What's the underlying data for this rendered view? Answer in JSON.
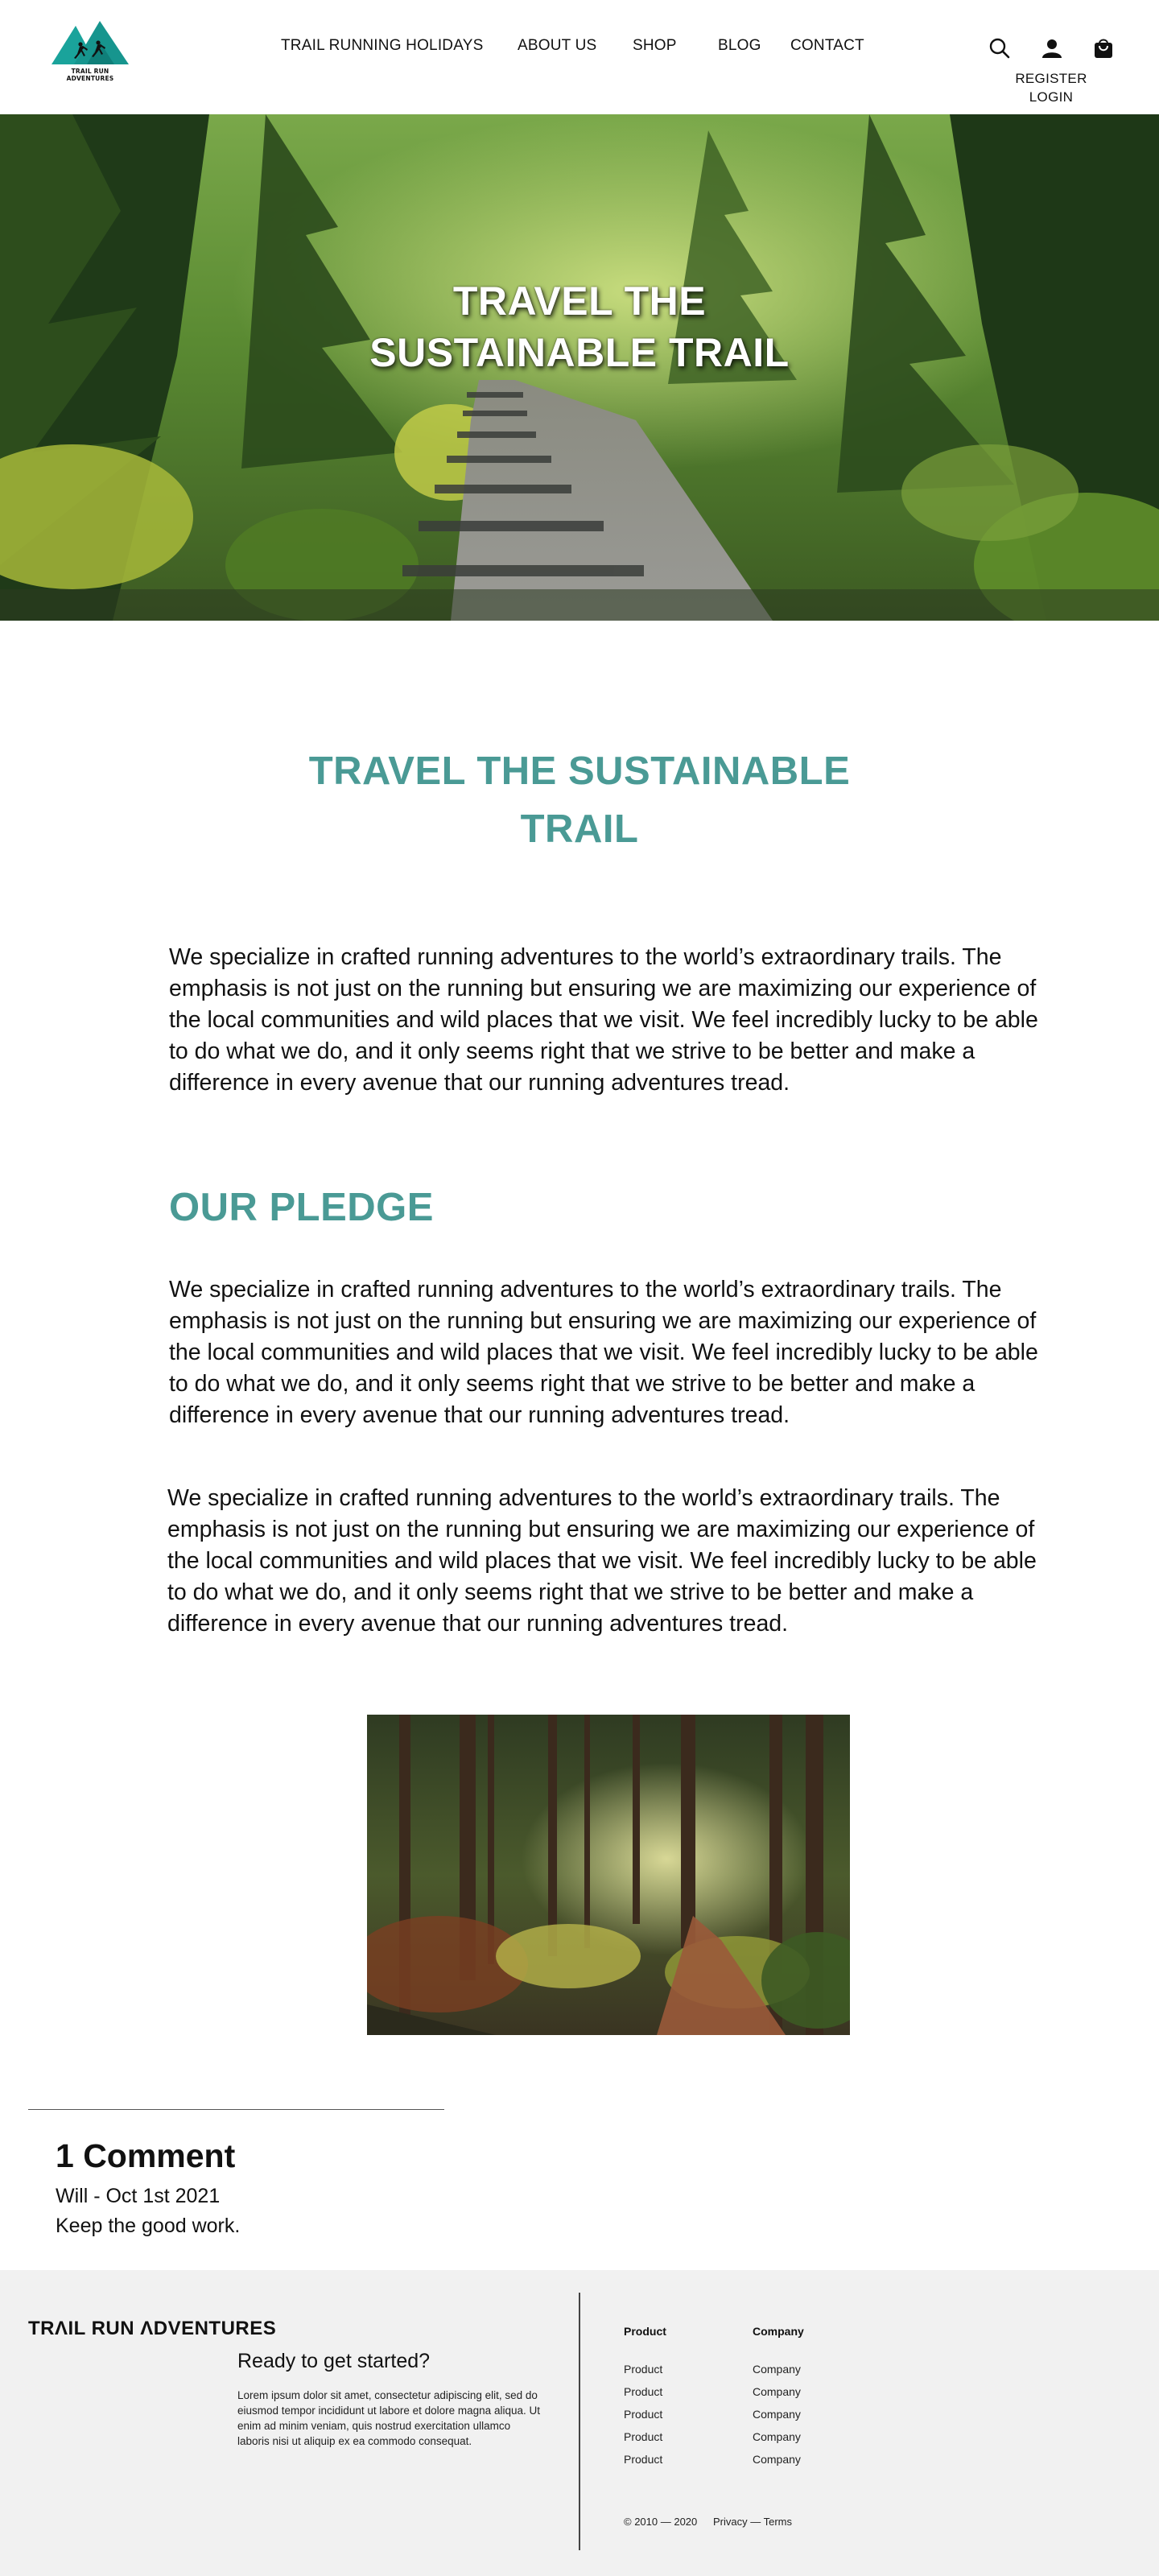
{
  "header": {
    "logo_text": "TRAIL RUN ADVENTURES",
    "nav": [
      "TRAIL RUNNING HOLIDAYS",
      "ABOUT US",
      "SHOP",
      "BLOG",
      "CONTACT"
    ],
    "icons": [
      "search-icon",
      "user-icon",
      "shopping-bag-icon"
    ],
    "register": "REGISTER",
    "login": "LOGIN"
  },
  "hero": {
    "title_line1": "TRAVEL THE",
    "title_line2": "SUSTAINABLE TRAIL"
  },
  "article": {
    "title_line1": "TRAVEL THE SUSTAINABLE",
    "title_line2": "TRAIL",
    "intro": "We specialize in crafted running adventures to the world’s extraordinary trails. The emphasis is not just on the running but ensuring we are maximizing our experience of the local communities and wild places that we visit. We feel incredibly lucky to be able to do what we do, and it only seems right that we strive to be better and make a difference in every avenue that our running adventures tread.",
    "pledge_heading": "OUR PLEDGE",
    "pledge_para1": "We specialize in crafted running adventures to the world’s extraordinary trails. The emphasis is not just on the running but ensuring we are maximizing our experience of the local communities and wild places that we visit. We feel incredibly lucky to be able to do what we do, and it only seems right that we strive to be better and make a difference in every avenue that our running adventures tread.",
    "pledge_para2": "We specialize in crafted running adventures to the world’s extraordinary trails. The emphasis is not just on the running but ensuring we are maximizing our experience of the local communities and wild places that we visit. We feel incredibly lucky to be able to do what we do, and it only seems right that we strive to be better and make a difference in every avenue that our running adventures tread."
  },
  "comments": {
    "count_label": "1 Comment",
    "items": [
      {
        "meta": "Will - Oct 1st  2021",
        "body": "Keep the good work."
      }
    ]
  },
  "footer": {
    "brand": "TRΛIL RUN ΛDVENTURES",
    "cta": "Ready to get started?",
    "lorem": "Lorem ipsum dolor sit amet, consectetur adipiscing elit, sed do eiusmod tempor incididunt ut labore et dolore magna aliqua. Ut enim ad minim veniam, quis nostrud exercitation ullamco laboris nisi ut aliquip ex ea commodo consequat.",
    "col1": {
      "heading": "Product",
      "items": [
        "Product",
        "Product",
        "Product",
        "Product",
        "Product"
      ]
    },
    "col2": {
      "heading": "Company",
      "items": [
        "Company",
        "Company",
        "Company",
        "Company",
        "Company"
      ]
    },
    "copyright": "© 2010 — 2020",
    "legal": "Privacy — Terms"
  },
  "colors": {
    "accent_teal": "#4a9a95",
    "logo_teal": "#1aa39b",
    "footer_bg": "#f1f1f1"
  }
}
